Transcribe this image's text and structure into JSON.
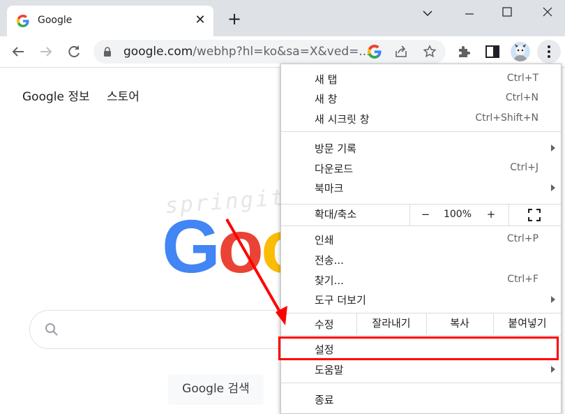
{
  "tab": {
    "title": "Google",
    "close": "✕"
  },
  "new_tab": "+",
  "window": {
    "minimize": "—",
    "maximize": "☐",
    "close": "✕",
    "tabsearch": "⌄"
  },
  "omnibox": {
    "host": "google.com",
    "path": "/webhp?hl=ko&sa=X&ved=..."
  },
  "page": {
    "links": [
      "Google 정보",
      "스토어"
    ],
    "logo_letters": [
      "G",
      "o",
      "o"
    ],
    "logo_colors": [
      "#4285f4",
      "#ea4335",
      "#fbbc05"
    ],
    "search_button": "Google 검색",
    "watermark": "springit.tistory.com"
  },
  "menu": {
    "new_tab": {
      "label": "새 탭",
      "shortcut": "Ctrl+T"
    },
    "new_window": {
      "label": "새 창",
      "shortcut": "Ctrl+N"
    },
    "incognito": {
      "label": "새 시크릿 창",
      "shortcut": "Ctrl+Shift+N"
    },
    "history": {
      "label": "방문 기록"
    },
    "downloads": {
      "label": "다운로드",
      "shortcut": "Ctrl+J"
    },
    "bookmarks": {
      "label": "북마크"
    },
    "zoom": {
      "label": "확대/축소",
      "minus": "−",
      "value": "100%",
      "plus": "+"
    },
    "print": {
      "label": "인쇄",
      "shortcut": "Ctrl+P"
    },
    "cast": {
      "label": "전송..."
    },
    "find": {
      "label": "찾기...",
      "shortcut": "Ctrl+F"
    },
    "more_tools": {
      "label": "도구 더보기"
    },
    "edit": {
      "label": "수정",
      "cut": "잘라내기",
      "copy": "복사",
      "paste": "붙여넣기"
    },
    "settings": {
      "label": "설정"
    },
    "help": {
      "label": "도움말"
    },
    "exit": {
      "label": "종료"
    }
  },
  "colors": {
    "highlight": "#ff0000",
    "arrow": "#ff0000"
  }
}
